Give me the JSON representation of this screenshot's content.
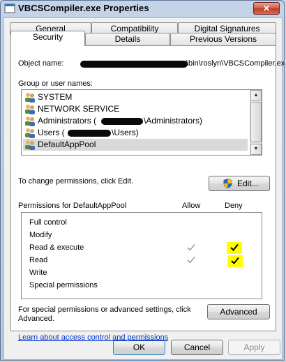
{
  "window": {
    "title": "VBCSCompiler.exe Properties",
    "close_label": "✕"
  },
  "tabs": {
    "row1": [
      "General",
      "Compatibility",
      "Digital Signatures"
    ],
    "row2": [
      "Security",
      "Details",
      "Previous Versions"
    ],
    "active": "Security"
  },
  "security": {
    "object_name_label": "Object name:",
    "object_name_value": "\\bin\\roslyn\\VBCSCompiler.exe",
    "group_label": "Group or user names:",
    "users": [
      "SYSTEM",
      "NETWORK SERVICE",
      "Administrators (",
      "Users (",
      "DefaultAppPool"
    ],
    "admin_suffix": "\\Administrators)",
    "users_suffix": "\\Users)",
    "selected_user": "DefaultAppPool",
    "change_text": "To change permissions, click Edit.",
    "edit_label": "Edit...",
    "permissions_label": "Permissions for DefaultAppPool",
    "allow_header": "Allow",
    "deny_header": "Deny",
    "permissions": [
      {
        "name": "Full control",
        "allow": false,
        "deny": false
      },
      {
        "name": "Modify",
        "allow": false,
        "deny": false
      },
      {
        "name": "Read & execute",
        "allow": true,
        "deny": true
      },
      {
        "name": "Read",
        "allow": true,
        "deny": true
      },
      {
        "name": "Write",
        "allow": false,
        "deny": false
      },
      {
        "name": "Special permissions",
        "allow": false,
        "deny": false
      }
    ],
    "special_text_line1": "For special permissions or advanced settings, click",
    "special_text_line2": "Advanced.",
    "advanced_label": "Advanced",
    "learn_link": "Learn about access control and permissions"
  },
  "buttons": {
    "ok": "OK",
    "cancel": "Cancel",
    "apply": "Apply"
  },
  "colors": {
    "highlight": "#ffff00",
    "link": "#0033cc",
    "selected_row": "#d9d9d9"
  }
}
